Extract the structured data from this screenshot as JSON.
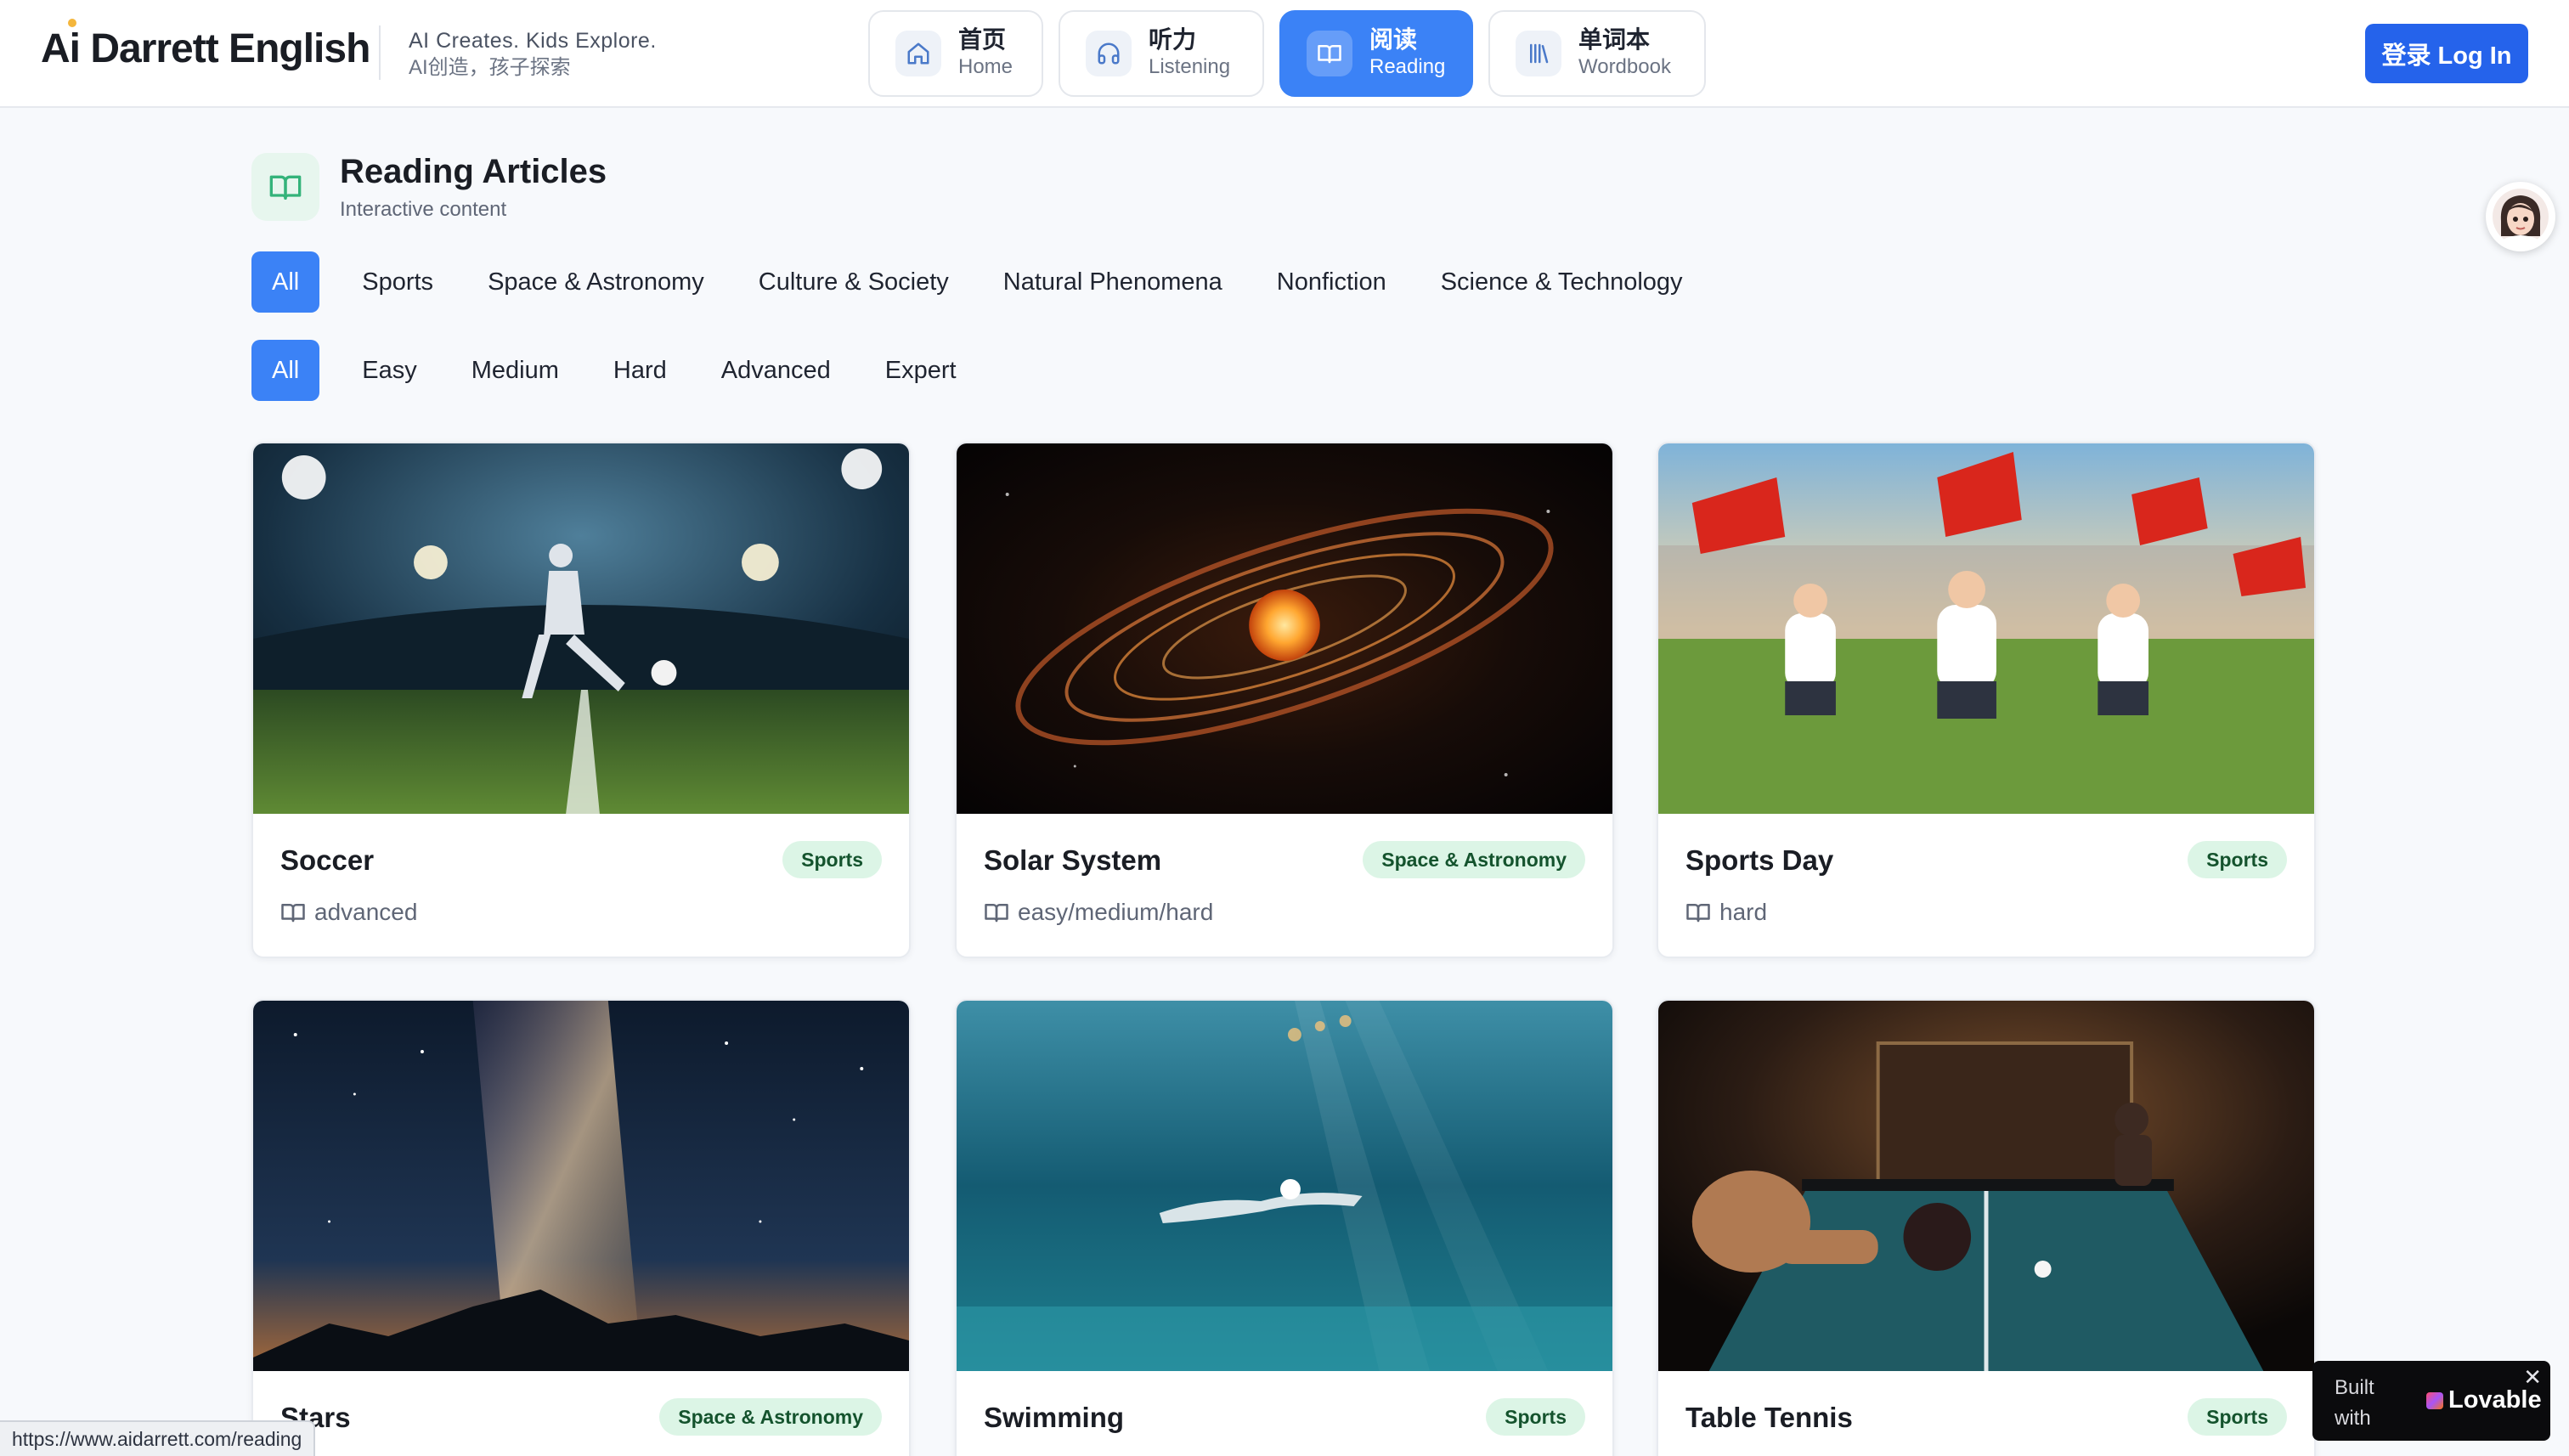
{
  "header": {
    "logo": "Ai Darrett English",
    "tagline_en": "AI Creates. Kids Explore.",
    "tagline_zh": "AI创造，孩子探索",
    "nav": [
      {
        "zh": "首页",
        "en": "Home",
        "icon": "home-icon"
      },
      {
        "zh": "听力",
        "en": "Listening",
        "icon": "headphones-icon"
      },
      {
        "zh": "阅读",
        "en": "Reading",
        "icon": "book-open-icon",
        "active": true
      },
      {
        "zh": "单词本",
        "en": "Wordbook",
        "icon": "library-icon"
      }
    ],
    "login_label": "登录 Log In"
  },
  "page": {
    "title": "Reading Articles",
    "subtitle": "Interactive content"
  },
  "filters": {
    "categories": [
      "All",
      "Sports",
      "Space & Astronomy",
      "Culture & Society",
      "Natural Phenomena",
      "Nonfiction",
      "Science & Technology"
    ],
    "selected_category": "All",
    "levels": [
      "All",
      "Easy",
      "Medium",
      "Hard",
      "Advanced",
      "Expert"
    ],
    "selected_level": "All"
  },
  "articles": [
    {
      "title": "Soccer",
      "category": "Sports",
      "level": "advanced"
    },
    {
      "title": "Solar System",
      "category": "Space & Astronomy",
      "level": "easy/medium/hard"
    },
    {
      "title": "Sports Day",
      "category": "Sports",
      "level": "hard"
    },
    {
      "title": "Stars",
      "category": "Space & Astronomy",
      "level": ""
    },
    {
      "title": "Swimming",
      "category": "Sports",
      "level": ""
    },
    {
      "title": "Table Tennis",
      "category": "Sports",
      "level": ""
    }
  ],
  "status_bar_url": "https://www.aidarrett.com/reading",
  "badge": {
    "built": "Built with",
    "brand": "Lovable",
    "close": "✕"
  },
  "colors": {
    "accent": "#3b82f6",
    "login": "#2563eb",
    "badge_bg": "#dcf5e6",
    "badge_text": "#14532d"
  }
}
